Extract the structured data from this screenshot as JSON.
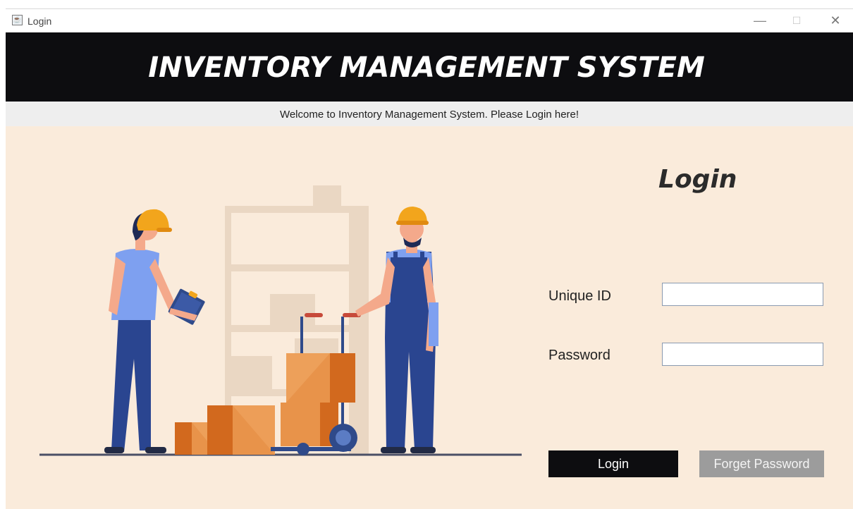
{
  "window": {
    "title": "Login",
    "icon": "java-cup-icon",
    "controls": {
      "minimize": "—",
      "maximize": "☐",
      "close": "✕"
    }
  },
  "header": {
    "title": "INVENTORY MANAGEMENT SYSTEM"
  },
  "welcome": {
    "text": "Welcome to Inventory Management System. Please Login here!"
  },
  "login": {
    "heading": "Login",
    "unique_id_label": "Unique ID",
    "unique_id_value": "",
    "password_label": "Password",
    "password_value": "",
    "login_button": "Login",
    "forget_button": "Forget Password"
  },
  "colors": {
    "header_bg": "#0d0d10",
    "main_bg": "#faebdb",
    "welcome_bg": "#eeeeee",
    "forget_button_bg": "#9c9c9c"
  }
}
